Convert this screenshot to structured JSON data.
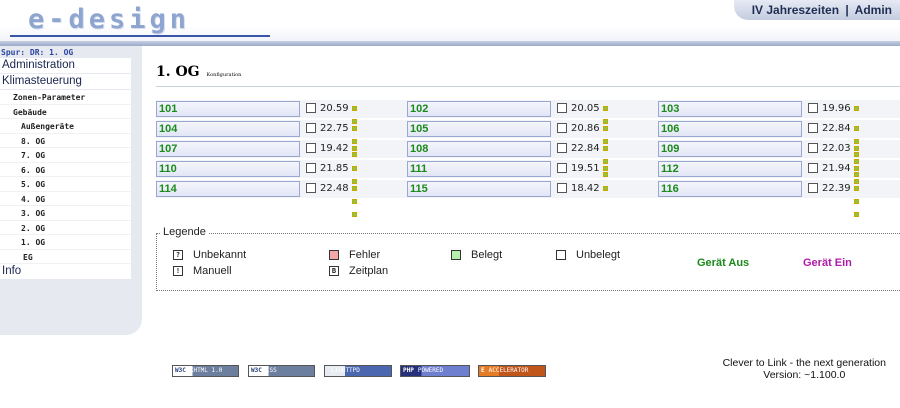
{
  "header": {
    "logo": "e-design",
    "location": "IV Jahreszeiten",
    "separator": "|",
    "user": "Admin"
  },
  "sidebar": {
    "trail": "Spur: DR: 1. OG",
    "items": [
      {
        "label": "Administration"
      },
      {
        "label": "Klimasteuerung"
      },
      {
        "label": "Zonen-Parameter"
      },
      {
        "label": "Gebäude"
      },
      {
        "label": "Außengeräte"
      },
      {
        "label": "8. OG"
      },
      {
        "label": "7. OG"
      },
      {
        "label": "6. OG"
      },
      {
        "label": "5. OG"
      },
      {
        "label": "4. OG"
      },
      {
        "label": "3. OG"
      },
      {
        "label": "2. OG"
      },
      {
        "label": "1. OG"
      },
      {
        "label": "EG"
      },
      {
        "label": "Info"
      }
    ]
  },
  "main": {
    "title": "1. OG",
    "subtitle": "Konfiguration",
    "rooms": [
      {
        "name": "101",
        "temp": "20.59",
        "dots": 2
      },
      {
        "name": "102",
        "temp": "20.05",
        "dots": 2
      },
      {
        "name": "103",
        "temp": "19.96",
        "dots": 1
      },
      {
        "name": "104",
        "temp": "22.75",
        "dots": 3
      },
      {
        "name": "105",
        "temp": "20.86",
        "dots": 2
      },
      {
        "name": "106",
        "temp": "22.84",
        "dots": 3
      },
      {
        "name": "107",
        "temp": "19.42",
        "dots": 1
      },
      {
        "name": "108",
        "temp": "22.84",
        "dots": 3
      },
      {
        "name": "109",
        "temp": "22.03",
        "dots": 3
      },
      {
        "name": "110",
        "temp": "21.85",
        "dots": 2
      },
      {
        "name": "111",
        "temp": "19.51",
        "dots": 1
      },
      {
        "name": "112",
        "temp": "21.94",
        "dots": 2
      },
      {
        "name": "114",
        "temp": "22.48",
        "dots": 3
      },
      {
        "name": "115",
        "temp": "18.42",
        "dots": 1
      },
      {
        "name": "116",
        "temp": "22.39",
        "dots": 3
      }
    ]
  },
  "legend": {
    "title": "Legende",
    "unknown": {
      "symbol": "?",
      "label": "Unbekannt"
    },
    "manual": {
      "symbol": "!",
      "label": "Manuell"
    },
    "error": {
      "label": "Fehler",
      "color": "#f2a9a9"
    },
    "schedule": {
      "symbol": "B",
      "label": "Zeitplan"
    },
    "occupied": {
      "label": "Belegt",
      "color": "#b7efb0"
    },
    "unoccupied": {
      "label": "Unbelegt",
      "color": "#ffffff"
    },
    "device_off": {
      "label": "Gerät Aus",
      "color": "#1a8a1a"
    },
    "device_on": {
      "label": "Gerät Ein",
      "color": "#b01aa8"
    }
  },
  "footer": {
    "badges": [
      {
        "left": "W3C",
        "right": "XHTML 1.0"
      },
      {
        "left": "W3C",
        "right": "CSS"
      },
      {
        "left": "",
        "right": "LIGHTTPD"
      },
      {
        "left": "PHP",
        "right": "POWERED"
      },
      {
        "left": "E",
        "right": "ACCELERATOR"
      }
    ],
    "line1": "Clever to Link - the next generation",
    "line2": "Version: ~1.100.0"
  }
}
